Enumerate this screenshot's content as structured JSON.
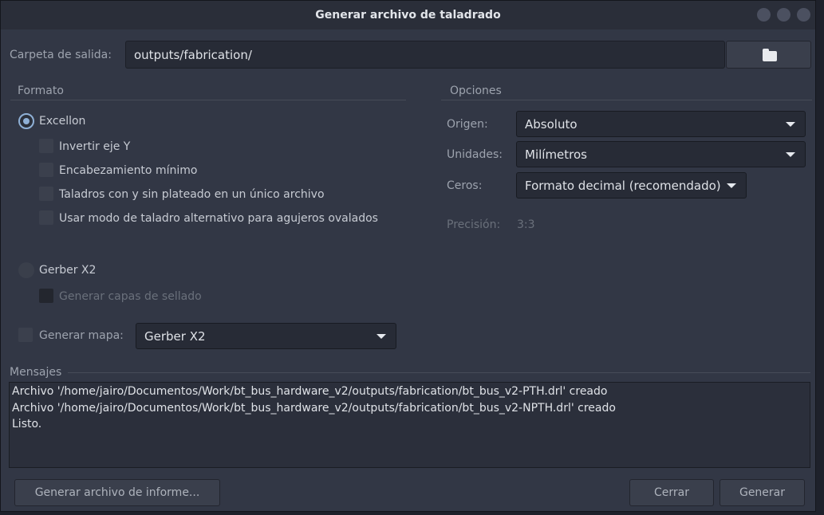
{
  "window": {
    "title": "Generar archivo de taladrado"
  },
  "output": {
    "label": "Carpeta de salida:",
    "value": "outputs/fabrication/"
  },
  "format": {
    "section_label": "Formato",
    "excellon": {
      "label": "Excellon",
      "selected": true,
      "options": [
        {
          "label": "Invertir eje Y",
          "checked": false
        },
        {
          "label": "Encabezamiento mínimo",
          "checked": false
        },
        {
          "label": "Taladros con y sin plateado en un único archivo",
          "checked": false
        },
        {
          "label": "Usar modo de taladro alternativo para agujeros ovalados",
          "checked": false
        }
      ]
    },
    "gerber": {
      "label": "Gerber X2",
      "selected": false,
      "option_label": "Generar capas de sellado"
    },
    "map": {
      "label": "Generar mapa:",
      "value": "Gerber X2"
    }
  },
  "options": {
    "section_label": "Opciones",
    "origin": {
      "label": "Origen:",
      "value": "Absoluto"
    },
    "units": {
      "label": "Unidades:",
      "value": "Milímetros"
    },
    "zeros": {
      "label": "Ceros:",
      "value": "Formato decimal (recomendado)"
    },
    "precision": {
      "label": "Precisión:",
      "value": "3:3"
    }
  },
  "messages": {
    "label": "Mensajes",
    "lines": [
      "Archivo '/home/jairo/Documentos/Work/bt_bus_hardware_v2/outputs/fabrication/bt_bus_v2-PTH.drl' creado",
      "Archivo '/home/jairo/Documentos/Work/bt_bus_hardware_v2/outputs/fabrication/bt_bus_v2-NPTH.drl' creado",
      "Listo."
    ]
  },
  "buttons": {
    "report": "Generar archivo de informe...",
    "close": "Cerrar",
    "generate": "Generar"
  }
}
